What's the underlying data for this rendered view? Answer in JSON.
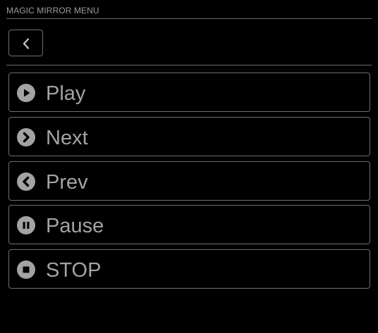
{
  "header": {
    "title": "MAGIC MIRROR MENU"
  },
  "back_button": {
    "icon": "chevron-left-icon"
  },
  "menu": {
    "items": [
      {
        "label": "Play",
        "icon": "play-circle-icon"
      },
      {
        "label": "Next",
        "icon": "chevron-right-circle-icon"
      },
      {
        "label": "Prev",
        "icon": "chevron-left-circle-icon"
      },
      {
        "label": "Pause",
        "icon": "pause-circle-icon"
      },
      {
        "label": "STOP",
        "icon": "stop-circle-icon"
      }
    ]
  },
  "colors": {
    "background": "#000000",
    "text": "#a3a3a3",
    "border": "#6f6f6f",
    "icon": "#a3a3a3"
  }
}
